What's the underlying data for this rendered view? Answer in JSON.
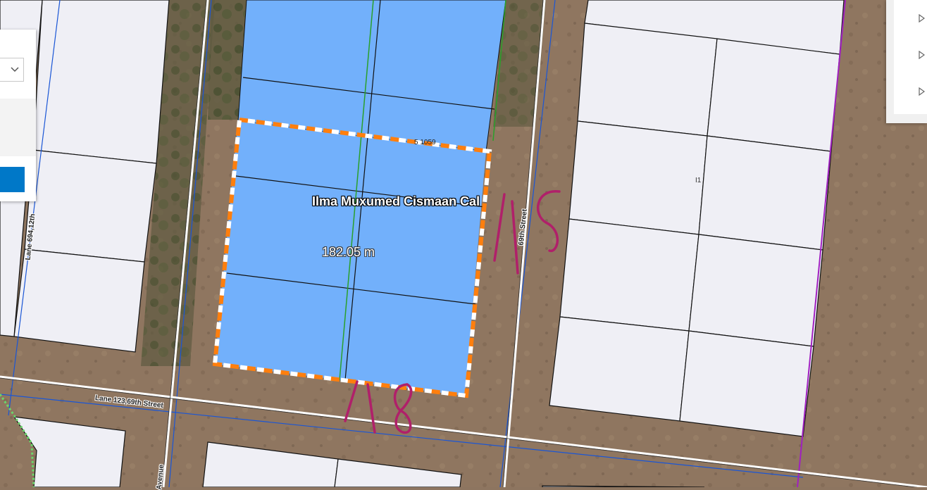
{
  "map": {
    "selected_parcel": {
      "owner_label": "Ilma Muxumed Cismaan Cal",
      "measurement": "182.05 m",
      "parcel_number_partial": "5 1059"
    },
    "streets": [
      {
        "label": "Lane 123,69th Street"
      },
      {
        "label": "69th Street"
      },
      {
        "label": "Lane 694,12th"
      },
      {
        "label": "Avenue"
      }
    ],
    "parcel_marker": "I1",
    "handwritten_annotations": [
      "115",
      "118"
    ],
    "colors": {
      "selected_fill": "#72b0fb",
      "selection_outline": "#ff7f0e",
      "parcel_fill": "#efeff5",
      "boundary_blue": "#1a56d6",
      "boundary_green": "#2aa02a",
      "boundary_purple": "#a020c0",
      "ink_annotation": "#b0206a",
      "panel_button": "#0078c8"
    }
  },
  "left_panel": {
    "dropdown_icon": "chevron-down-icon",
    "button_color": "#0078c8"
  },
  "right_panel": {
    "items": [
      {
        "icon": "expand-arrow-icon"
      },
      {
        "icon": "expand-arrow-icon"
      },
      {
        "icon": "expand-arrow-icon"
      }
    ]
  }
}
